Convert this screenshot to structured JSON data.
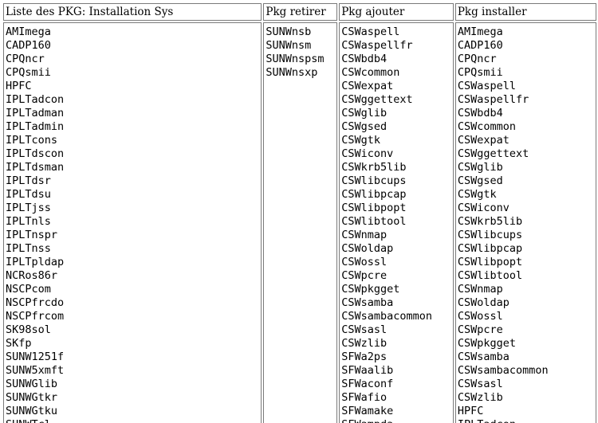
{
  "headers": {
    "installation": "Liste des PKG: Installation Sys",
    "retirer": "Pkg retirer",
    "ajouter": "Pkg ajouter",
    "installer": "Pkg installer"
  },
  "installation_list": [
    "AMImega",
    "CADP160",
    "CPQncr",
    "CPQsmii",
    "HPFC",
    "IPLTadcon",
    "IPLTadman",
    "IPLTadmin",
    "IPLTcons",
    "IPLTdscon",
    "IPLTdsman",
    "IPLTdsr",
    "IPLTdsu",
    "IPLTjss",
    "IPLTnls",
    "IPLTnspr",
    "IPLTnss",
    "IPLTpldap",
    "NCRos86r",
    "NSCPcom",
    "NSCPfrcdo",
    "NSCPfrcom",
    "SK98sol",
    "SKfp",
    "SUNW1251f",
    "SUNW5xmft",
    "SUNWGlib",
    "SUNWGtkr",
    "SUNWGtku",
    "SUNWTcl"
  ],
  "retirer_list": [
    "SUNWnsb",
    "SUNWnsm",
    "SUNWnspsm",
    "SUNWnsxp"
  ],
  "ajouter_list": [
    "CSWaspell",
    "CSWaspellfr",
    "CSWbdb4",
    "CSWcommon",
    "CSWexpat",
    "CSWggettext",
    "CSWglib",
    "CSWgsed",
    "CSWgtk",
    "CSWiconv",
    "CSWkrb5lib",
    "CSWlibcups",
    "CSWlibpcap",
    "CSWlibpopt",
    "CSWlibtool",
    "CSWnmap",
    "CSWoldap",
    "CSWossl",
    "CSWpcre",
    "CSWpkgget",
    "CSWsamba",
    "CSWsambacommon",
    "CSWsasl",
    "CSWzlib",
    "SFWa2ps",
    "SFWaalib",
    "SFWaconf",
    "SFWafio",
    "SFWamake",
    "SFWampda"
  ],
  "installer_list": [
    "AMImega",
    "CADP160",
    "CPQncr",
    "CPQsmii",
    "CSWaspell",
    "CSWaspellfr",
    "CSWbdb4",
    "CSWcommon",
    "CSWexpat",
    "CSWggettext",
    "CSWglib",
    "CSWgsed",
    "CSWgtk",
    "CSWiconv",
    "CSWkrb5lib",
    "CSWlibcups",
    "CSWlibpcap",
    "CSWlibpopt",
    "CSWlibtool",
    "CSWnmap",
    "CSWoldap",
    "CSWossl",
    "CSWpcre",
    "CSWpkgget",
    "CSWsamba",
    "CSWsambacommon",
    "CSWsasl",
    "CSWzlib",
    "HPFC",
    "IPLTadcon"
  ]
}
